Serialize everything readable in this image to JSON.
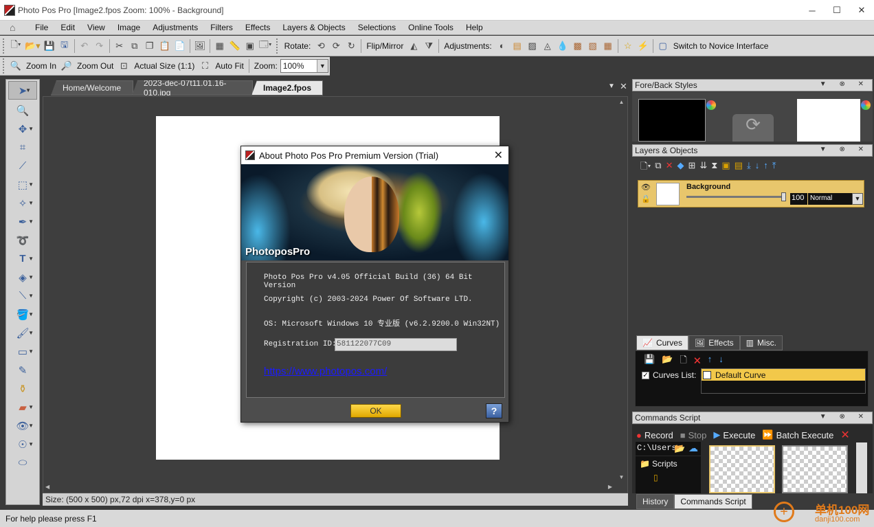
{
  "window": {
    "title": "Photo Pos Pro [Image2.fpos Zoom: 100% - Background]",
    "min": "─",
    "max": "☐",
    "close": "✕"
  },
  "menu": [
    "File",
    "Edit",
    "View",
    "Image",
    "Adjustments",
    "Filters",
    "Effects",
    "Layers & Objects",
    "Selections",
    "Online Tools",
    "Help"
  ],
  "toolbar1": {
    "rotate": "Rotate:",
    "flip": "Flip/Mirror",
    "adjustments": "Adjustments:",
    "novice": "Switch to Novice Interface"
  },
  "toolbar2": {
    "zoom_in": "Zoom In",
    "zoom_out": "Zoom Out",
    "actual_size": "Actual Size (1:1)",
    "auto_fit": "Auto Fit",
    "zoom_label": "Zoom:",
    "zoom_value": "100%"
  },
  "doc_tabs": [
    "Home/Welcome",
    "2023-dec-07t11.01.16-010.jpg",
    "Image2.fpos"
  ],
  "image_status": "Size: (500 x 500) px,72 dpi   x=378,y=0 px",
  "status": "For help please press F1",
  "panels": {
    "fore_back": "Fore/Back Styles",
    "layers": "Layers & Objects",
    "layer_name": "Background",
    "layer_opacity": "100",
    "layer_mode": "Normal",
    "tabs": [
      "Curves",
      "Effects",
      "Misc."
    ],
    "curves_list_label": "Curves List:",
    "curve_item": "Default Curve",
    "commands": "Commands Script",
    "record": "Record",
    "stop": "Stop",
    "execute": "Execute",
    "batch": "Batch Execute",
    "path": "C:\\Users",
    "folder1": "Scripts",
    "bottom_tabs": [
      "History",
      "Commands Script"
    ]
  },
  "dialog": {
    "title": "About Photo Pos Pro Premium Version (Trial)",
    "logo": "PhotoposPro",
    "line1": "Photo Pos Pro v4.05 Official Build (36) 64 Bit Version",
    "line2": "Copyright (c) 2003-2024 Power Of Software LTD.",
    "line3": "OS: Microsoft Windows 10 专业版 (v6.2.9200.0 Win32NT)",
    "reg_label": "Registration ID:",
    "reg_value": "581122077C09",
    "link": "https://www.photopos.com/",
    "ok": "OK",
    "help": "?"
  },
  "watermark": "单机100网",
  "watermark_sub": "danji100.com"
}
